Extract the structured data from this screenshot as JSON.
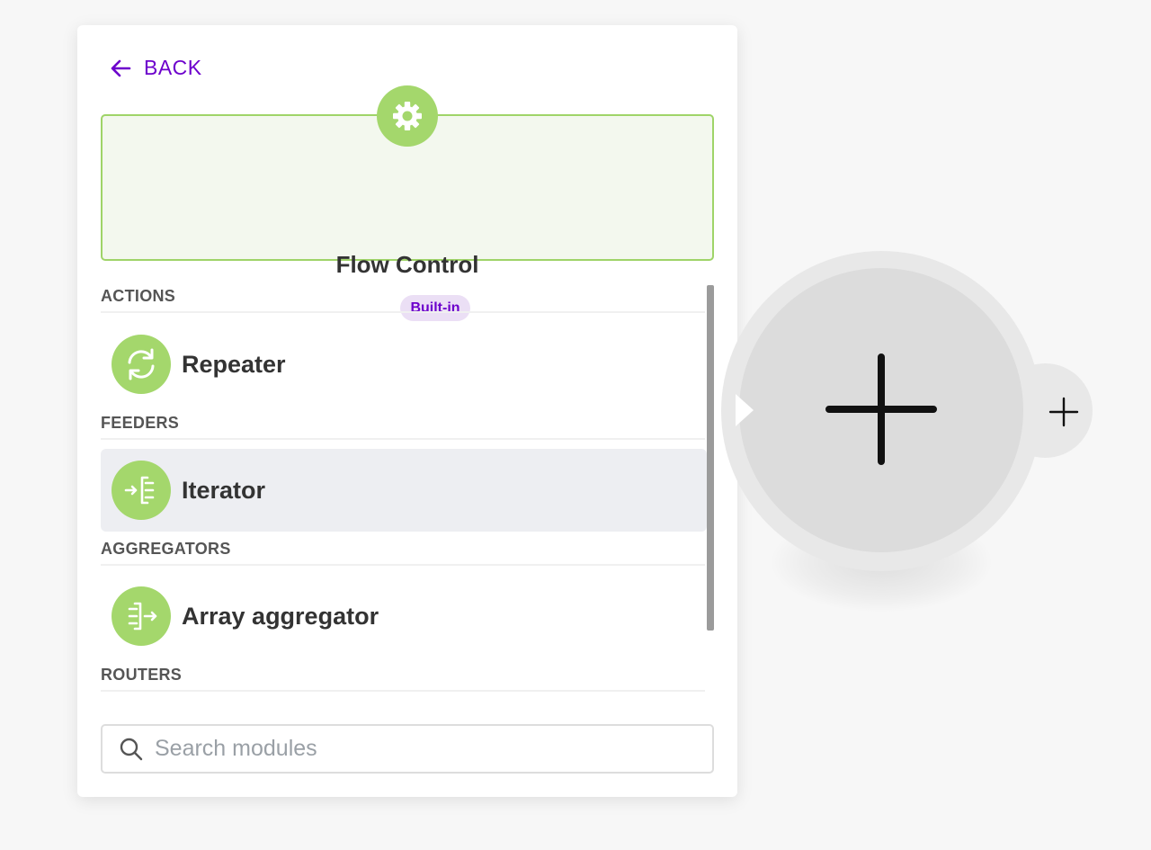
{
  "panel": {
    "back_label": "BACK",
    "app": {
      "title": "Flow Control",
      "badge": "Built-in",
      "icon": "gear-icon"
    },
    "sections": [
      {
        "header": "ACTIONS",
        "modules": [
          {
            "name": "Repeater",
            "icon": "repeat-icon",
            "selected": false
          }
        ]
      },
      {
        "header": "FEEDERS",
        "modules": [
          {
            "name": "Iterator",
            "icon": "iterator-icon",
            "selected": true
          }
        ]
      },
      {
        "header": "AGGREGATORS",
        "modules": [
          {
            "name": "Array aggregator",
            "icon": "array-aggregator-icon",
            "selected": false
          }
        ]
      },
      {
        "header": "ROUTERS",
        "modules": []
      }
    ],
    "search": {
      "placeholder": "Search modules",
      "value": ""
    }
  },
  "canvas": {
    "node_icon": "plus-icon",
    "add_next_icon": "plus-icon"
  },
  "colors": {
    "accent": "#6d00cc",
    "app_green": "#a4d76c",
    "app_card_bg": "#f3f8ee",
    "app_card_border": "#9fd468",
    "selected_row": "#edeef2",
    "badge_bg": "#ebdff5"
  }
}
